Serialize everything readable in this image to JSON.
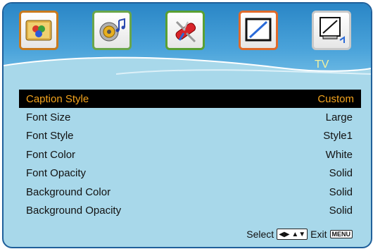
{
  "tabs": [
    {
      "name": "picture",
      "icon": "palette-icon",
      "border": "#c97a1e"
    },
    {
      "name": "sound",
      "icon": "speaker-music-icon",
      "border": "#6aa64a"
    },
    {
      "name": "setup",
      "icon": "swiss-knife-icon",
      "border": "#5aa032"
    },
    {
      "name": "screen",
      "icon": "monitor-icon",
      "border": "#e06a2a"
    },
    {
      "name": "tv",
      "icon": "tv-antenna-icon",
      "border": "#c9c9c9"
    }
  ],
  "active_tab_label": "TV",
  "menu": {
    "items": [
      {
        "label": "Caption Style",
        "value": "Custom",
        "selected": true
      },
      {
        "label": "Font Size",
        "value": "Large"
      },
      {
        "label": "Font Style",
        "value": "Style1"
      },
      {
        "label": "Font Color",
        "value": "White"
      },
      {
        "label": "Font Opacity",
        "value": "Solid"
      },
      {
        "label": "Background Color",
        "value": "Solid"
      },
      {
        "label": "Background Opacity",
        "value": "Solid"
      }
    ]
  },
  "footer": {
    "select_label": "Select",
    "exit_label": "Exit",
    "menu_key": "MENU"
  },
  "colors": {
    "highlight_text": "#f3a31d",
    "panel": "#a8d8ea",
    "header": "#2a86c6"
  }
}
